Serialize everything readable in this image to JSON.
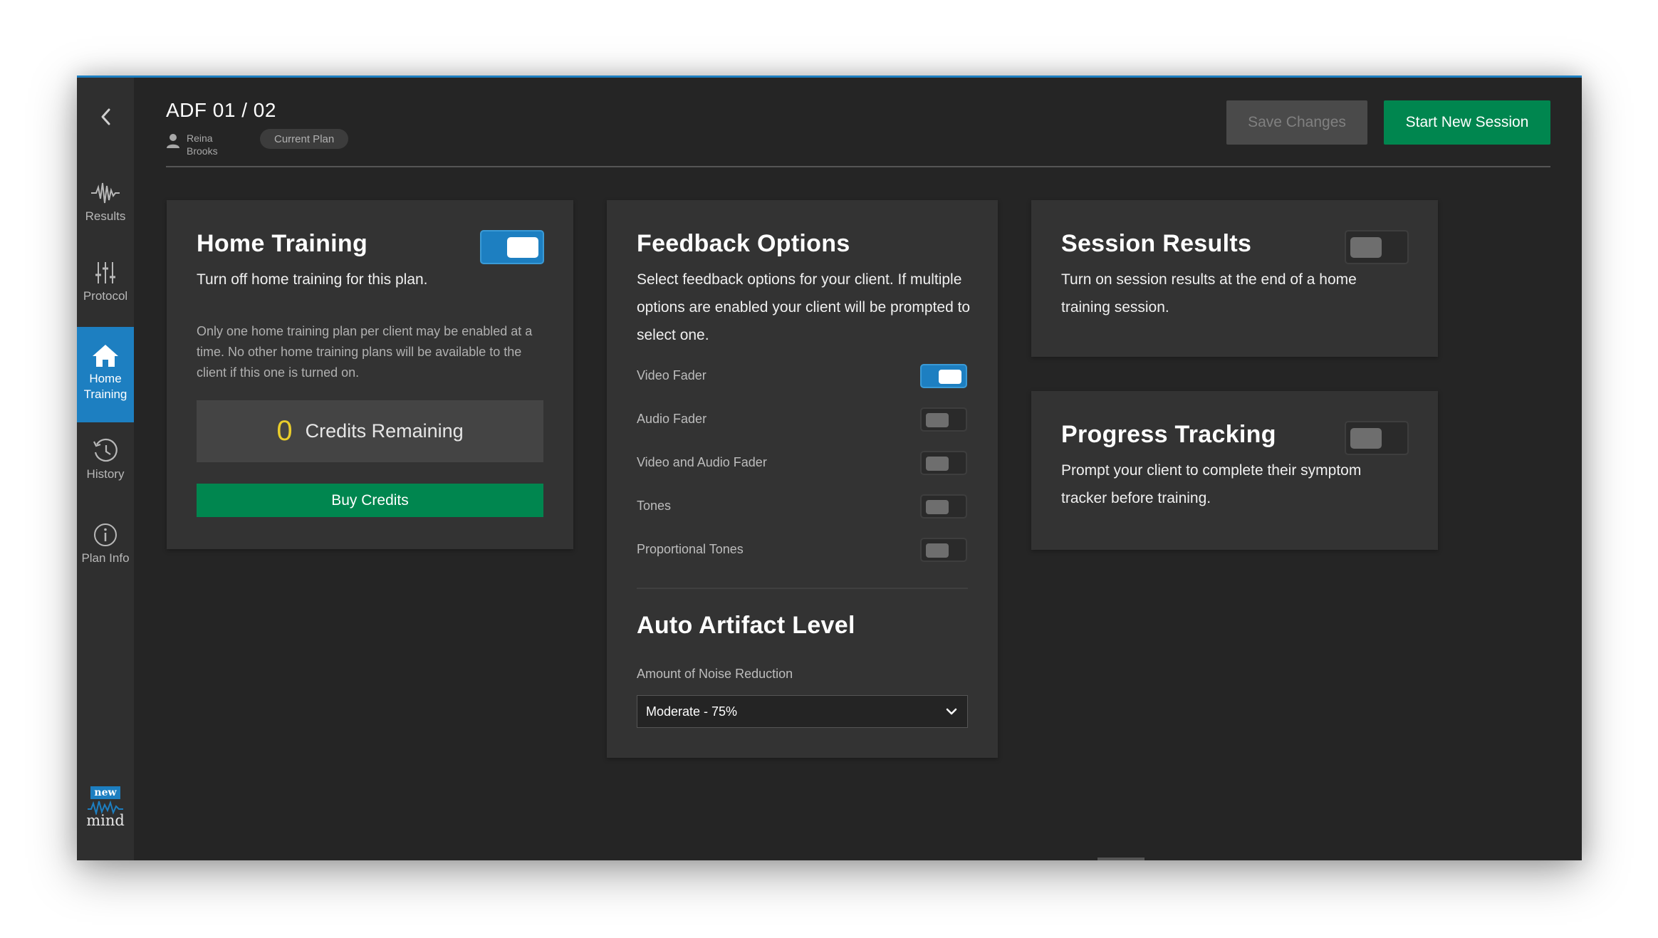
{
  "header": {
    "plan_title": "ADF 01 / 02",
    "client_name": "Reina Brooks",
    "plan_badge": "Current Plan",
    "save_label": "Save Changes",
    "start_label": "Start New Session"
  },
  "sidebar": {
    "items": [
      {
        "label": "Results",
        "icon": "waveform-icon"
      },
      {
        "label": "Protocol",
        "icon": "sliders-icon"
      },
      {
        "label": "Home Training",
        "icon": "home-icon",
        "active": true
      },
      {
        "label": "History",
        "icon": "history-icon"
      },
      {
        "label": "Plan Info",
        "icon": "info-icon"
      }
    ],
    "logo_top": "new",
    "logo_bottom": "mind"
  },
  "home_training": {
    "title": "Home Training",
    "subtitle": "Turn off home training for this plan.",
    "note": "Only one home training plan per client may be enabled at a time. No other home training plans will be available to the client if this one is turned on.",
    "toggle_on": true,
    "credits_count": "0",
    "credits_label": "Credits Remaining",
    "buy_label": "Buy Credits"
  },
  "feedback": {
    "title": "Feedback Options",
    "description": "Select feedback options for your client. If multiple options are enabled your client will be prompted to select one.",
    "options": [
      {
        "label": "Video Fader",
        "on": true
      },
      {
        "label": "Audio Fader",
        "on": false
      },
      {
        "label": "Video and Audio Fader",
        "on": false
      },
      {
        "label": "Tones",
        "on": false
      },
      {
        "label": "Proportional Tones",
        "on": false
      }
    ],
    "artifact_title": "Auto Artifact Level",
    "noise_label": "Amount of Noise Reduction",
    "noise_value": "Moderate - 75%"
  },
  "session_results": {
    "title": "Session Results",
    "description": "Turn on session results at the end of a home training session.",
    "toggle_on": false
  },
  "progress_tracking": {
    "title": "Progress Tracking",
    "description": "Prompt your client to complete their symptom tracker before training.",
    "toggle_on": false
  },
  "colors": {
    "accent_blue": "#1d7fc1",
    "green": "#00864f",
    "credits_yellow": "#e9cd2b",
    "background": "#252525"
  }
}
